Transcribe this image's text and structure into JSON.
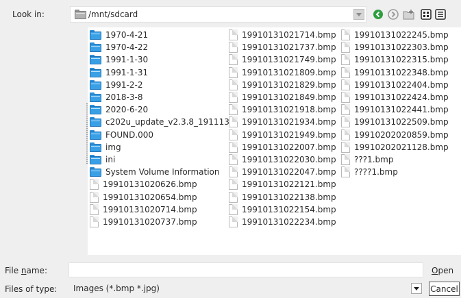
{
  "look_in": {
    "label": "Look in:",
    "path": "/mnt/sdcard"
  },
  "toolbar": {
    "back_icon": "back-arrow-icon",
    "forward_icon": "forward-arrow-icon",
    "new_folder_icon": "new-folder-icon",
    "list_view_icon": "list-view-icon",
    "detail_view_icon": "detail-view-icon",
    "accent_green": "#2e9e3e",
    "disabled_gray": "#9a9a9a"
  },
  "files": {
    "column1": [
      {
        "name": "1970-4-21",
        "type": "folder"
      },
      {
        "name": "1970-4-22",
        "type": "folder"
      },
      {
        "name": "1991-1-30",
        "type": "folder"
      },
      {
        "name": "1991-1-31",
        "type": "folder"
      },
      {
        "name": "1991-2-2",
        "type": "folder"
      },
      {
        "name": "2018-3-8",
        "type": "folder"
      },
      {
        "name": "2020-6-20",
        "type": "folder"
      },
      {
        "name": "c202u_update_v2.3.8_191113",
        "type": "folder"
      },
      {
        "name": "FOUND.000",
        "type": "folder"
      },
      {
        "name": "img",
        "type": "folder"
      },
      {
        "name": "ini",
        "type": "folder"
      },
      {
        "name": "System Volume Information",
        "type": "folder"
      },
      {
        "name": "19910131020626.bmp",
        "type": "file"
      },
      {
        "name": "19910131020654.bmp",
        "type": "file"
      },
      {
        "name": "19910131020714.bmp",
        "type": "file"
      },
      {
        "name": "19910131020737.bmp",
        "type": "file"
      }
    ],
    "column2": [
      {
        "name": "19910131021714.bmp",
        "type": "file"
      },
      {
        "name": "19910131021737.bmp",
        "type": "file"
      },
      {
        "name": "19910131021749.bmp",
        "type": "file"
      },
      {
        "name": "19910131021809.bmp",
        "type": "file"
      },
      {
        "name": "19910131021829.bmp",
        "type": "file"
      },
      {
        "name": "19910131021849.bmp",
        "type": "file"
      },
      {
        "name": "19910131021918.bmp",
        "type": "file"
      },
      {
        "name": "19910131021934.bmp",
        "type": "file"
      },
      {
        "name": "19910131021949.bmp",
        "type": "file"
      },
      {
        "name": "19910131022007.bmp",
        "type": "file"
      },
      {
        "name": "19910131022030.bmp",
        "type": "file"
      },
      {
        "name": "19910131022047.bmp",
        "type": "file"
      },
      {
        "name": "19910131022121.bmp",
        "type": "file"
      },
      {
        "name": "19910131022138.bmp",
        "type": "file"
      },
      {
        "name": "19910131022154.bmp",
        "type": "file"
      },
      {
        "name": "19910131022234.bmp",
        "type": "file"
      }
    ],
    "column3": [
      {
        "name": "19910131022245.bmp",
        "type": "file"
      },
      {
        "name": "19910131022303.bmp",
        "type": "file"
      },
      {
        "name": "19910131022315.bmp",
        "type": "file"
      },
      {
        "name": "19910131022348.bmp",
        "type": "file"
      },
      {
        "name": "19910131022404.bmp",
        "type": "file"
      },
      {
        "name": "19910131022424.bmp",
        "type": "file"
      },
      {
        "name": "19910131022441.bmp",
        "type": "file"
      },
      {
        "name": "19910131022509.bmp",
        "type": "file"
      },
      {
        "name": "19910202020859.bmp",
        "type": "file"
      },
      {
        "name": "19910202021128.bmp",
        "type": "file"
      },
      {
        "name": "???1.bmp",
        "type": "file"
      },
      {
        "name": "????1.bmp",
        "type": "file"
      }
    ]
  },
  "file_name": {
    "label_prefix": "File ",
    "label_mnemonic": "n",
    "label_suffix": "ame:",
    "value": ""
  },
  "files_of_type": {
    "label": "Files of type:",
    "value": "Images (*.bmp *.jpg)"
  },
  "buttons": {
    "open_mnemonic": "O",
    "open_rest": "pen",
    "cancel": "Cancel"
  }
}
